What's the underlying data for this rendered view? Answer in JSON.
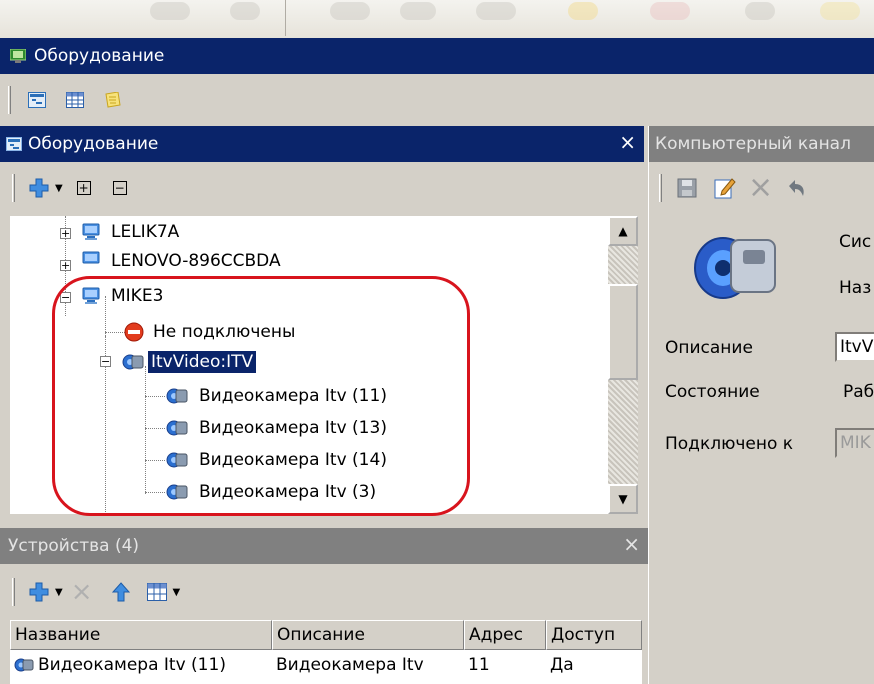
{
  "main_window": {
    "title": "Оборудование",
    "icon": "monitor-icon"
  },
  "view_toolbar": {
    "buttons": [
      "tree-view-icon",
      "grid-view-icon",
      "notes-icon"
    ]
  },
  "tree_panel": {
    "title": "Оборудование",
    "toolbar": {
      "add": "add-plus-icon",
      "expand_all": "+",
      "collapse_all": "−"
    },
    "items": {
      "lelik": "LELIK7A",
      "lenovo": "LENOVO-896CCBDA",
      "mike": "MIKE3",
      "not_connected": "Не подключены",
      "itv": "ItvVideo:ITV",
      "cam1": "Видеокамера Itv (11)",
      "cam2": "Видеокамера Itv (13)",
      "cam3": "Видеокамера Itv (14)",
      "cam4": "Видеокамера Itv (3)"
    }
  },
  "devices_panel": {
    "title": "Устройства (4)",
    "columns": {
      "name": "Название",
      "desc": "Описание",
      "addr": "Адрес",
      "access": "Доступ"
    },
    "row": {
      "name": "Видеокамера Itv (11)",
      "desc": "Видеокамера Itv",
      "addr": "11",
      "access": "Да"
    }
  },
  "right_panel": {
    "title": "Компьютерный канал",
    "partial_labels": {
      "system": "Сис",
      "name": "Наз"
    },
    "props": {
      "description_label": "Описание",
      "description_value": "ItvV",
      "state_label": "Состояние",
      "state_value": "Раб",
      "connected_label": "Подключено к",
      "connected_value": "MIK"
    }
  },
  "colors": {
    "titlebar_active": "#0a246a",
    "titlebar_inactive": "#808080",
    "highlight": "#d8141d",
    "window_bg": "#d4d0c8"
  }
}
